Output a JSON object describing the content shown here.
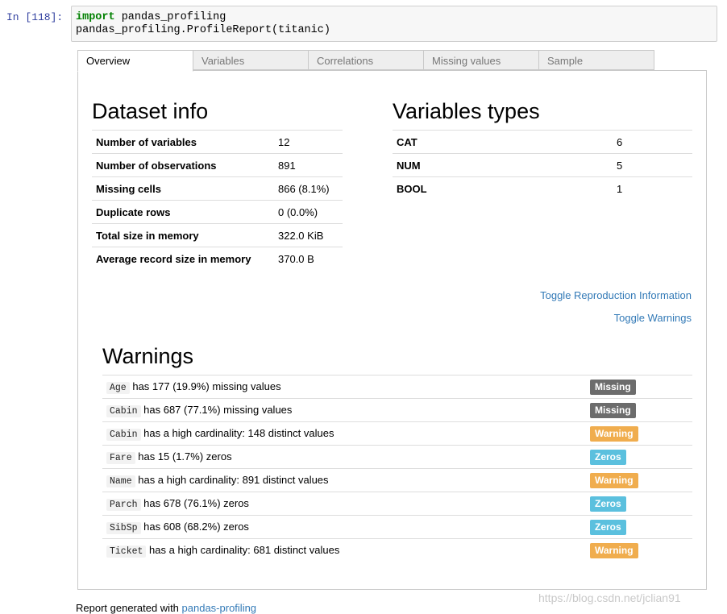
{
  "cell": {
    "prompt": "In [118]:",
    "line1_keyword": "import",
    "line1_rest": " pandas_profiling",
    "line2": "pandas_profiling.ProfileReport(titanic)"
  },
  "tabs": [
    {
      "label": "Overview",
      "active": true
    },
    {
      "label": "Variables",
      "active": false
    },
    {
      "label": "Correlations",
      "active": false
    },
    {
      "label": "Missing values",
      "active": false
    },
    {
      "label": "Sample",
      "active": false
    }
  ],
  "dataset_info": {
    "title": "Dataset info",
    "rows": [
      {
        "label": "Number of variables",
        "value": "12"
      },
      {
        "label": "Number of observations",
        "value": "891"
      },
      {
        "label": "Missing cells",
        "value": "866 (8.1%)"
      },
      {
        "label": "Duplicate rows",
        "value": "0 (0.0%)"
      },
      {
        "label": "Total size in memory",
        "value": "322.0 KiB"
      },
      {
        "label": "Average record size in memory",
        "value": "370.0 B"
      }
    ]
  },
  "variable_types": {
    "title": "Variables types",
    "rows": [
      {
        "label": "CAT",
        "value": "6"
      },
      {
        "label": "NUM",
        "value": "5"
      },
      {
        "label": "BOOL",
        "value": "1"
      }
    ]
  },
  "links": {
    "toggle_reproduction": "Toggle Reproduction Information",
    "toggle_warnings": "Toggle Warnings"
  },
  "warnings": {
    "title": "Warnings",
    "rows": [
      {
        "variable": "Age",
        "message": "has 177 (19.9%) missing values",
        "badge": "Missing",
        "badge_color": "#6c6c6c"
      },
      {
        "variable": "Cabin",
        "message": "has 687 (77.1%) missing values",
        "badge": "Missing",
        "badge_color": "#6c6c6c"
      },
      {
        "variable": "Cabin",
        "message": "has a high cardinality: 148 distinct values",
        "badge": "Warning",
        "badge_color": "#f0ad4e"
      },
      {
        "variable": "Fare",
        "message": "has 15 (1.7%) zeros",
        "badge": "Zeros",
        "badge_color": "#5bc0de"
      },
      {
        "variable": "Name",
        "message": "has a high cardinality: 891 distinct values",
        "badge": "Warning",
        "badge_color": "#f0ad4e"
      },
      {
        "variable": "Parch",
        "message": "has 678 (76.1%) zeros",
        "badge": "Zeros",
        "badge_color": "#5bc0de"
      },
      {
        "variable": "SibSp",
        "message": "has 608 (68.2%) zeros",
        "badge": "Zeros",
        "badge_color": "#5bc0de"
      },
      {
        "variable": "Ticket",
        "message": "has a high cardinality: 681 distinct values",
        "badge": "Warning",
        "badge_color": "#f0ad4e"
      }
    ]
  },
  "footer": {
    "text": "Report generated with ",
    "link": "pandas-profiling"
  },
  "watermark": "https://blog.csdn.net/jclian91"
}
